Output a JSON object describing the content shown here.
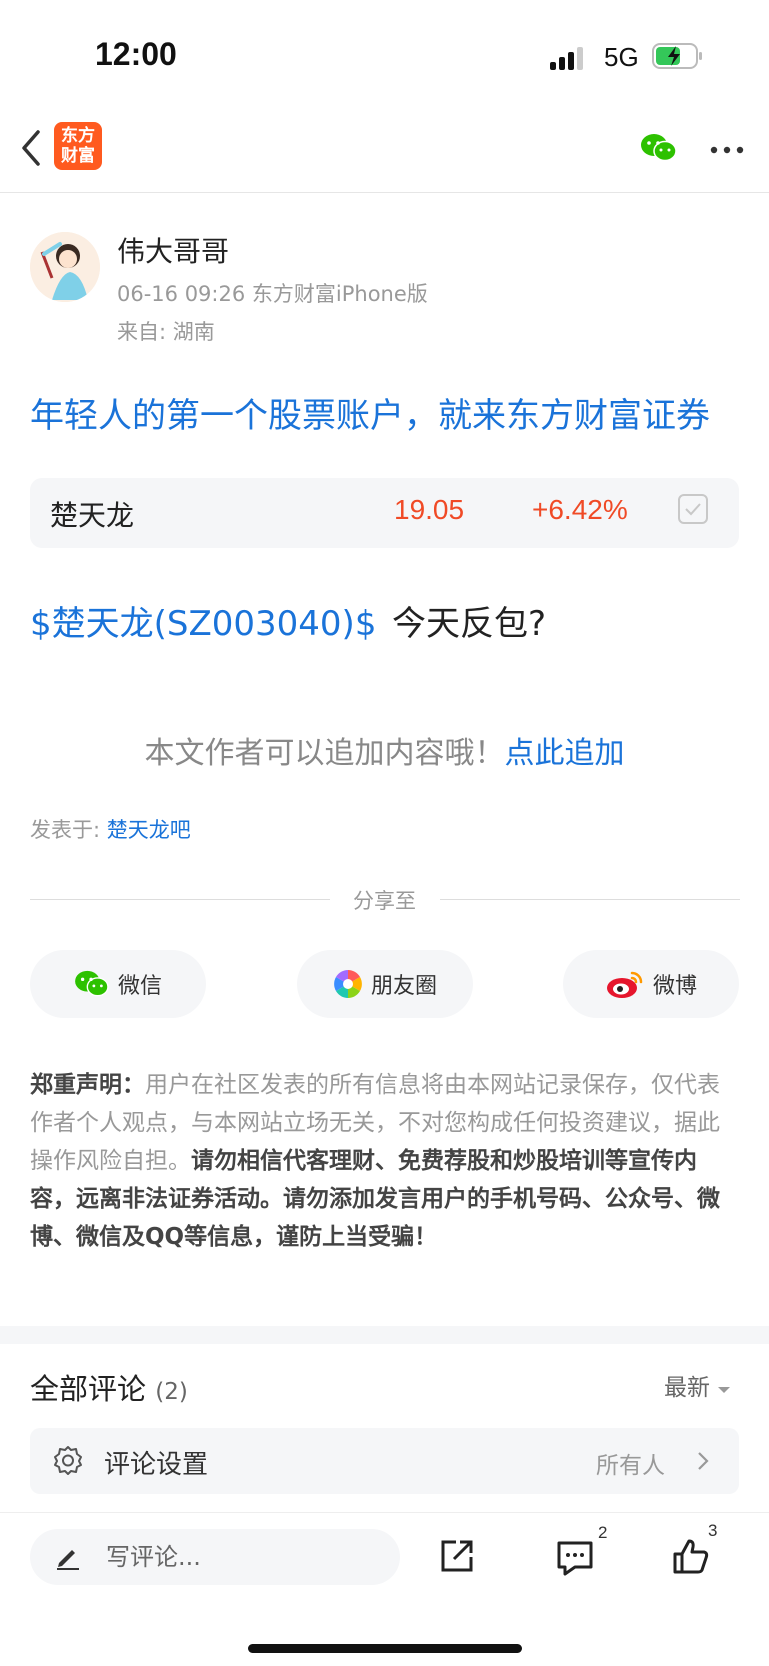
{
  "status": {
    "time": "12:00",
    "network": "5G"
  },
  "nav": {
    "logo_line1": "东方",
    "logo_line2": "财富"
  },
  "post": {
    "username": "伟大哥哥",
    "meta": "06-16 09:26 东方财富iPhone版",
    "location": "来自: 湖南",
    "ad_link": "年轻人的第一个股票账户，就来东方财富证券",
    "stock": {
      "name": "楚天龙",
      "price": "19.05",
      "change": "+6.42%"
    },
    "tag": "$楚天龙(SZ003040)$",
    "text": "今天反包?",
    "append_prompt": "本文作者可以追加内容哦！",
    "append_link": "点此追加",
    "posted_in_label": "发表于:",
    "posted_in_bar": "楚天龙吧"
  },
  "share": {
    "title": "分享至",
    "buttons": [
      {
        "label": "微信"
      },
      {
        "label": "朋友圈"
      },
      {
        "label": "微博"
      }
    ]
  },
  "disclaimer": {
    "heading": "郑重声明：",
    "normal": "用户在社区发表的所有信息将由本网站记录保存，仅代表作者个人观点，与本网站立场无关，不对您构成任何投资建议，据此操作风险自担。",
    "bold": "请勿相信代客理财、免费荐股和炒股培训等宣传内容，远离非法证券活动。请勿添加发言用户的手机号码、公众号、微博、微信及QQ等信息，谨防上当受骗！"
  },
  "comments": {
    "title": "全部评论",
    "count": "(2)",
    "sort": "最新",
    "settings_label": "评论设置",
    "settings_value": "所有人"
  },
  "bottom": {
    "input_placeholder": "写评论...",
    "comment_badge": "2",
    "like_badge": "3"
  },
  "colors": {
    "brand_orange": "#ff5a1f",
    "link_blue": "#1a73d9",
    "up_red": "#f04a26",
    "wechat_green": "#2dc100"
  },
  "icons": [
    "back-arrow-icon",
    "wechat-icon",
    "more-icon",
    "checkbox-icon",
    "moments-icon",
    "weibo-icon",
    "gear-icon",
    "chevron-right-icon",
    "pencil-icon",
    "share-icon",
    "comment-icon",
    "like-icon"
  ]
}
